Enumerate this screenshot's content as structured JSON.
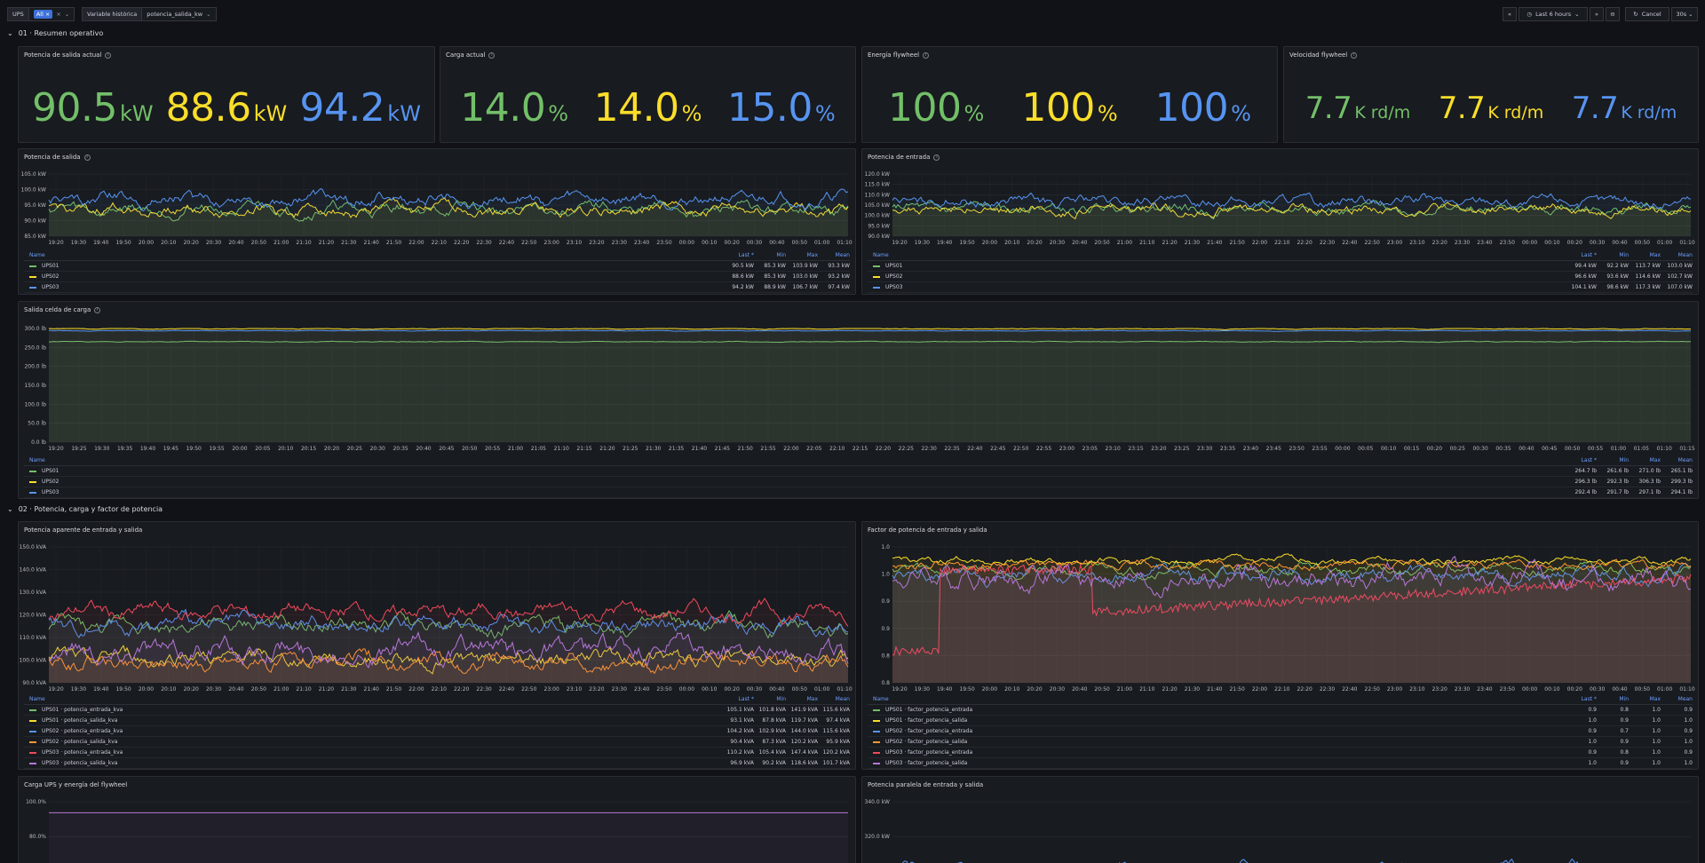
{
  "toolbar": {
    "ups_label": "UPS",
    "ups_value": "All",
    "var_label": "Variable histórica",
    "var_value": "potencia_salida_kw",
    "time_range": "Last 6 hours",
    "cancel_label": "Cancel",
    "refresh": "30s"
  },
  "colors": {
    "green": "#73bf69",
    "yellow": "#fade2a",
    "blue": "#5794f2",
    "red": "#f2495c",
    "orange": "#ff9830",
    "purple": "#b877d9"
  },
  "icons": [
    "close-icon",
    "chevron-down-icon",
    "chevron-left-double-icon",
    "chevron-right-double-icon",
    "clock-icon",
    "zoom-out-icon",
    "refresh-icon",
    "info-icon"
  ],
  "row1": {
    "title": "01 · Resumen operativo"
  },
  "row2": {
    "title": "02 · Potencia, carga y factor de potencia"
  },
  "stats": {
    "potencia": {
      "title": "Potencia de salida actual",
      "values": [
        {
          "num": "90.5",
          "unit": "kW"
        },
        {
          "num": "88.6",
          "unit": "kW"
        },
        {
          "num": "94.2",
          "unit": "kW"
        }
      ]
    },
    "carga": {
      "title": "Carga actual",
      "values": [
        {
          "num": "14.0",
          "unit": "%"
        },
        {
          "num": "14.0",
          "unit": "%"
        },
        {
          "num": "15.0",
          "unit": "%"
        }
      ]
    },
    "energia": {
      "title": "Energía flywheel",
      "values": [
        {
          "num": "100",
          "unit": "%"
        },
        {
          "num": "100",
          "unit": "%"
        },
        {
          "num": "100",
          "unit": "%"
        }
      ]
    },
    "velocidad": {
      "title": "Velocidad flywheel",
      "values": [
        {
          "num": "7.7",
          "unit": "K rd/m"
        },
        {
          "num": "7.7",
          "unit": "K rd/m"
        },
        {
          "num": "7.7",
          "unit": "K rd/m"
        }
      ]
    }
  },
  "legend_headers": {
    "name": "Name",
    "last": "Last *",
    "min": "Min",
    "max": "Max",
    "mean": "Mean"
  },
  "panels": {
    "salida": {
      "title": "Potencia de salida",
      "legend": [
        {
          "name": "UPS01",
          "last": "90.5 kW",
          "min": "85.3 kW",
          "max": "103.9 kW",
          "mean": "93.3 kW",
          "color": "#73bf69"
        },
        {
          "name": "UPS02",
          "last": "88.6 kW",
          "min": "85.3 kW",
          "max": "103.0 kW",
          "mean": "93.2 kW",
          "color": "#fade2a"
        },
        {
          "name": "UPS03",
          "last": "94.2 kW",
          "min": "88.9 kW",
          "max": "106.7 kW",
          "mean": "97.4 kW",
          "color": "#5794f2"
        }
      ]
    },
    "entrada": {
      "title": "Potencia de entrada",
      "legend": [
        {
          "name": "UPS01",
          "last": "99.4 kW",
          "min": "92.2 kW",
          "max": "113.7 kW",
          "mean": "103.0 kW",
          "color": "#73bf69"
        },
        {
          "name": "UPS02",
          "last": "96.6 kW",
          "min": "93.6 kW",
          "max": "114.6 kW",
          "mean": "102.7 kW",
          "color": "#fade2a"
        },
        {
          "name": "UPS03",
          "last": "104.1 kW",
          "min": "98.6 kW",
          "max": "117.3 kW",
          "mean": "107.0 kW",
          "color": "#5794f2"
        }
      ]
    },
    "celda": {
      "title": "Salida celda de carga",
      "legend": [
        {
          "name": "UPS01",
          "last": "264.7 lb",
          "min": "261.6 lb",
          "max": "271.0 lb",
          "mean": "265.1 lb",
          "color": "#73bf69"
        },
        {
          "name": "UPS02",
          "last": "296.3 lb",
          "min": "292.3 lb",
          "max": "306.3 lb",
          "mean": "299.3 lb",
          "color": "#fade2a"
        },
        {
          "name": "UPS03",
          "last": "292.4 lb",
          "min": "291.7 lb",
          "max": "297.1 lb",
          "mean": "294.1 lb",
          "color": "#5794f2"
        }
      ]
    },
    "aparente": {
      "title": "Potencia aparente de entrada y salida",
      "legend": [
        {
          "name": "UPS01 · potencia_entrada_kva",
          "last": "105.1 kVA",
          "min": "101.8 kVA",
          "max": "141.9 kVA",
          "mean": "115.6 kVA",
          "color": "#73bf69"
        },
        {
          "name": "UPS01 · potencia_salida_kva",
          "last": "93.1 kVA",
          "min": "87.8 kVA",
          "max": "119.7 kVA",
          "mean": "97.4 kVA",
          "color": "#fade2a"
        },
        {
          "name": "UPS02 · potencia_entrada_kva",
          "last": "104.2 kVA",
          "min": "102.9 kVA",
          "max": "144.0 kVA",
          "mean": "115.6 kVA",
          "color": "#5794f2"
        },
        {
          "name": "UPS02 · potencia_salida_kva",
          "last": "90.4 kVA",
          "min": "87.3 kVA",
          "max": "120.2 kVA",
          "mean": "95.9 kVA",
          "color": "#ff9830"
        },
        {
          "name": "UPS03 · potencia_entrada_kva",
          "last": "110.2 kVA",
          "min": "105.4 kVA",
          "max": "147.4 kVA",
          "mean": "120.2 kVA",
          "color": "#f2495c"
        },
        {
          "name": "UPS03 · potencia_salida_kva",
          "last": "96.9 kVA",
          "min": "90.2 kVA",
          "max": "118.6 kVA",
          "mean": "101.7 kVA",
          "color": "#b877d9"
        }
      ]
    },
    "factor": {
      "title": "Factor de potencia de entrada y salida",
      "legend": [
        {
          "name": "UPS01 · factor_potencia_entrada",
          "last": "0.9",
          "min": "0.8",
          "max": "1.0",
          "mean": "0.9",
          "color": "#73bf69"
        },
        {
          "name": "UPS01 · factor_potencia_salida",
          "last": "1.0",
          "min": "0.9",
          "max": "1.0",
          "mean": "1.0",
          "color": "#fade2a"
        },
        {
          "name": "UPS02 · factor_potencia_entrada",
          "last": "0.9",
          "min": "0.7",
          "max": "1.0",
          "mean": "0.9",
          "color": "#5794f2"
        },
        {
          "name": "UPS02 · factor_potencia_salida",
          "last": "1.0",
          "min": "0.9",
          "max": "1.0",
          "mean": "1.0",
          "color": "#ff9830"
        },
        {
          "name": "UPS03 · factor_potencia_entrada",
          "last": "0.9",
          "min": "0.8",
          "max": "1.0",
          "mean": "0.9",
          "color": "#f2495c"
        },
        {
          "name": "UPS03 · factor_potencia_salida",
          "last": "1.0",
          "min": "0.9",
          "max": "1.0",
          "mean": "1.0",
          "color": "#b877d9"
        }
      ]
    },
    "flywheel": {
      "title": "Carga UPS y energía del flywheel"
    },
    "paralela": {
      "title": "Potencia paralela de entrada y salida"
    }
  },
  "chart_data": [
    {
      "id": "salida",
      "type": "line",
      "y_ticks": [
        "105.0 kW",
        "100.0 kW",
        "95.0 kW",
        "90.0 kW",
        "85.0 kW"
      ],
      "ylim": [
        83,
        107
      ],
      "x_ticks": [
        "19:20",
        "19:30",
        "19:40",
        "19:50",
        "20:00",
        "20:10",
        "20:20",
        "20:30",
        "20:40",
        "20:50",
        "21:00",
        "21:10",
        "21:20",
        "21:30",
        "21:40",
        "21:50",
        "22:00",
        "22:10",
        "22:20",
        "22:30",
        "22:40",
        "22:50",
        "23:00",
        "23:10",
        "23:20",
        "23:30",
        "23:40",
        "23:50",
        "00:00",
        "00:10",
        "00:20",
        "00:30",
        "00:40",
        "00:50",
        "01:00",
        "01:10"
      ],
      "series": [
        {
          "name": "UPS01",
          "color": "#73bf69",
          "base": 93.3,
          "amp": 3.0
        },
        {
          "name": "UPS02",
          "color": "#fade2a",
          "base": 93.2,
          "amp": 3.0
        },
        {
          "name": "UPS03",
          "color": "#5794f2",
          "base": 97.4,
          "amp": 3.2
        }
      ]
    },
    {
      "id": "entrada",
      "type": "line",
      "y_ticks": [
        "120.0 kW",
        "115.0 kW",
        "110.0 kW",
        "105.0 kW",
        "100.0 kW",
        "95.0 kW",
        "90.0 kW"
      ],
      "ylim": [
        89,
        121
      ],
      "x_ticks": [
        "19:20",
        "19:30",
        "19:40",
        "19:50",
        "20:00",
        "20:10",
        "20:20",
        "20:30",
        "20:40",
        "20:50",
        "21:00",
        "21:10",
        "21:20",
        "21:30",
        "21:40",
        "21:50",
        "22:00",
        "22:10",
        "22:20",
        "22:30",
        "22:40",
        "22:50",
        "23:00",
        "23:10",
        "23:20",
        "23:30",
        "23:40",
        "23:50",
        "00:00",
        "00:10",
        "00:20",
        "00:30",
        "00:40",
        "00:50",
        "01:00",
        "01:10"
      ],
      "series": [
        {
          "name": "UPS01",
          "color": "#73bf69",
          "base": 103.0,
          "amp": 3.4
        },
        {
          "name": "UPS02",
          "color": "#fade2a",
          "base": 102.7,
          "amp": 3.4
        },
        {
          "name": "UPS03",
          "color": "#5794f2",
          "base": 107.0,
          "amp": 3.6
        }
      ]
    },
    {
      "id": "celda",
      "type": "line",
      "y_ticks": [
        "300.0 lb",
        "250.0 lb",
        "200.0 lb",
        "150.0 lb",
        "100.0 lb",
        "50.0 lb",
        "0.0 lb"
      ],
      "ylim": [
        0,
        300
      ],
      "x_ticks": [
        "19:20",
        "19:25",
        "19:30",
        "19:35",
        "19:40",
        "19:45",
        "19:50",
        "19:55",
        "20:00",
        "20:05",
        "20:10",
        "20:15",
        "20:20",
        "20:25",
        "20:30",
        "20:35",
        "20:40",
        "20:45",
        "20:50",
        "20:55",
        "21:00",
        "21:05",
        "21:10",
        "21:15",
        "21:20",
        "21:25",
        "21:30",
        "21:35",
        "21:40",
        "21:45",
        "21:50",
        "21:55",
        "22:00",
        "22:05",
        "22:10",
        "22:15",
        "22:20",
        "22:25",
        "22:30",
        "22:35",
        "22:40",
        "22:45",
        "22:50",
        "22:55",
        "23:00",
        "23:05",
        "23:10",
        "23:15",
        "23:20",
        "23:25",
        "23:30",
        "23:35",
        "23:40",
        "23:45",
        "23:50",
        "23:55",
        "00:00",
        "00:05",
        "00:10",
        "00:15",
        "00:20",
        "00:25",
        "00:30",
        "00:35",
        "00:40",
        "00:45",
        "00:50",
        "00:55",
        "01:00",
        "01:05",
        "01:10",
        "01:15"
      ],
      "series": [
        {
          "name": "UPS01",
          "color": "#73bf69",
          "base": 265.1,
          "amp": 1.2
        },
        {
          "name": "UPS02",
          "color": "#fade2a",
          "base": 299.3,
          "amp": 1.5
        },
        {
          "name": "UPS03",
          "color": "#5794f2",
          "base": 294.1,
          "amp": 1.0
        }
      ]
    },
    {
      "id": "aparente",
      "type": "line",
      "y_ticks": [
        "150.0 kVA",
        "140.0 kVA",
        "130.0 kVA",
        "120.0 kVA",
        "110.0 kVA",
        "100.0 kVA",
        "90.0 kVA"
      ],
      "ylim": [
        85,
        152
      ],
      "x_ticks": [
        "19:20",
        "19:30",
        "19:40",
        "19:50",
        "20:00",
        "20:10",
        "20:20",
        "20:30",
        "20:40",
        "20:50",
        "21:00",
        "21:10",
        "21:20",
        "21:30",
        "21:40",
        "21:50",
        "22:00",
        "22:10",
        "22:20",
        "22:30",
        "22:40",
        "22:50",
        "23:00",
        "23:10",
        "23:20",
        "23:30",
        "23:40",
        "23:50",
        "00:00",
        "00:10",
        "00:20",
        "00:30",
        "00:40",
        "00:50",
        "01:00",
        "01:10"
      ],
      "series": [
        {
          "name": "UPS01 · potencia_entrada_kva",
          "color": "#73bf69",
          "base": 113,
          "amp": 5
        },
        {
          "name": "UPS01 · potencia_salida_kva",
          "color": "#fade2a",
          "base": 97,
          "amp": 5
        },
        {
          "name": "UPS02 · potencia_entrada_kva",
          "color": "#5794f2",
          "base": 114,
          "amp": 5
        },
        {
          "name": "UPS02 · potencia_salida_kva",
          "color": "#ff9830",
          "base": 95,
          "amp": 5
        },
        {
          "name": "UPS03 · potencia_entrada_kva",
          "color": "#f2495c",
          "base": 120,
          "amp": 5
        },
        {
          "name": "UPS03 · potencia_salida_kva",
          "color": "#b877d9",
          "base": 101,
          "amp": 7
        }
      ]
    },
    {
      "id": "factor",
      "type": "line",
      "y_ticks": [
        "1.0",
        "1.0",
        "0.9",
        "0.9",
        "0.8",
        "0.8"
      ],
      "ylim": [
        0.72,
        1.02
      ],
      "x_ticks": [
        "19:20",
        "19:30",
        "19:40",
        "19:50",
        "20:00",
        "20:10",
        "20:20",
        "20:30",
        "20:40",
        "20:50",
        "21:00",
        "21:10",
        "21:20",
        "21:30",
        "21:40",
        "21:50",
        "22:00",
        "22:10",
        "22:20",
        "22:30",
        "22:40",
        "22:50",
        "23:00",
        "23:10",
        "23:20",
        "23:30",
        "23:40",
        "23:50",
        "00:00",
        "00:10",
        "00:20",
        "00:30",
        "00:40",
        "00:50",
        "01:00",
        "01:10"
      ],
      "series": [
        {
          "name": "UPS01 · factor_potencia_entrada",
          "color": "#73bf69",
          "base": 0.97,
          "amp": 0.015
        },
        {
          "name": "UPS01 · factor_potencia_salida",
          "color": "#fade2a",
          "base": 0.99,
          "amp": 0.01
        },
        {
          "name": "UPS02 · factor_potencia_entrada",
          "color": "#5794f2",
          "base": 0.96,
          "amp": 0.02
        },
        {
          "name": "UPS02 · factor_potencia_salida",
          "color": "#ff9830",
          "base": 0.98,
          "amp": 0.012
        },
        {
          "name": "UPS03 · factor_potencia_entrada",
          "color": "#f2495c",
          "base": 0.87,
          "amp": 0.02
        },
        {
          "name": "UPS03 · factor_potencia_salida",
          "color": "#b877d9",
          "base": 0.95,
          "amp": 0.03
        }
      ]
    },
    {
      "id": "flywheel",
      "type": "line",
      "y_ticks": [
        "100.0%",
        "80.0%"
      ],
      "ylim": [
        60,
        105
      ],
      "series": [
        {
          "name": "",
          "color": "#b877d9",
          "base": 100,
          "amp": 0
        }
      ]
    },
    {
      "id": "paralela",
      "type": "line",
      "y_ticks": [
        "340.0 kW",
        "320.0 kW"
      ],
      "ylim": [
        290,
        350
      ],
      "series": [
        {
          "name": "",
          "color": "#5794f2",
          "base": 308,
          "amp": 5
        },
        {
          "name": "",
          "color": "#f2495c",
          "base": 306,
          "amp": 5
        },
        {
          "name": "",
          "color": "#b877d9",
          "base": 305,
          "amp": 4
        }
      ]
    }
  ]
}
